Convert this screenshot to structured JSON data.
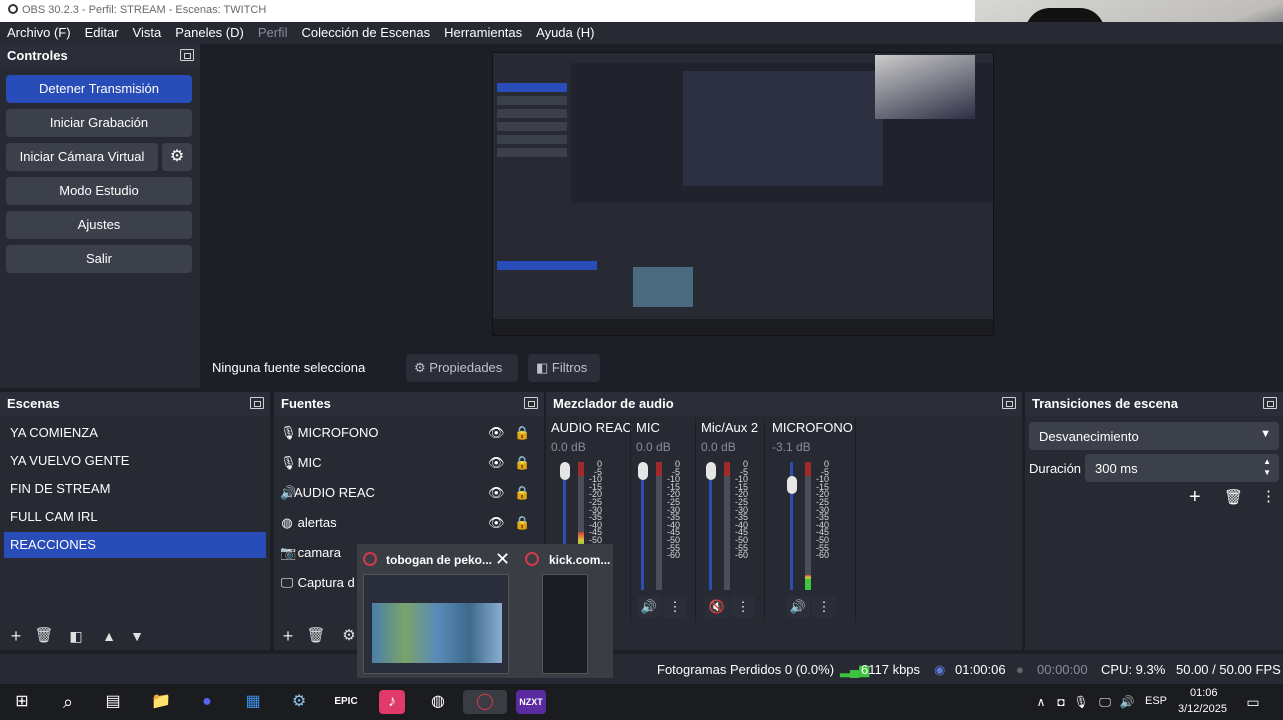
{
  "window": {
    "title": "OBS 30.2.3 - Perfil: STREAM - Escenas: TWITCH"
  },
  "menu": [
    "Archivo (F)",
    "Editar",
    "Vista",
    "Paneles (D)",
    "Perfil",
    "Colección de Escenas",
    "Herramientas",
    "Ayuda (H)"
  ],
  "controls": {
    "title": "Controles",
    "stop_stream": "Detener Transmisión",
    "start_recording": "Iniciar Grabación",
    "virtual_cam": "Iniciar Cámara Virtual",
    "studio_mode": "Modo Estudio",
    "settings": "Ajustes",
    "exit": "Salir"
  },
  "context_bar": {
    "no_source": "Ninguna fuente seleccionada",
    "properties": "Propiedades",
    "filters": "Filtros"
  },
  "scenes": {
    "title": "Escenas",
    "items": [
      "YA COMIENZA",
      "YA VUELVO GENTE",
      "FIN DE STREAM",
      "FULL CAM IRL",
      "REACCIONES"
    ],
    "selected": "REACCIONES"
  },
  "sources": {
    "title": "Fuentes",
    "items": [
      {
        "name": "MICROFONO",
        "icon": "mic-icon"
      },
      {
        "name": "MIC",
        "icon": "mic-icon"
      },
      {
        "name": "AUDIO REAC",
        "icon": "speaker-icon"
      },
      {
        "name": "alertas",
        "icon": "browser-icon"
      },
      {
        "name": "camara",
        "icon": "camera-icon"
      },
      {
        "name": "Captura d",
        "icon": "monitor-icon"
      }
    ]
  },
  "mixer": {
    "title": "Mezclador de audio",
    "channels": [
      {
        "name": "AUDIO REAC",
        "db": "0.0 dB",
        "muted": true,
        "level": 0.45
      },
      {
        "name": "MIC",
        "db": "0.0 dB",
        "muted": false,
        "level": 0.0
      },
      {
        "name": "Mic/Aux 2",
        "db": "0.0 dB",
        "muted": true,
        "level": 0.0
      },
      {
        "name": "MICROFONO",
        "db": "-3.1 dB",
        "muted": false,
        "level": 0.12
      }
    ],
    "scale": [
      "0",
      "-5",
      "-10",
      "-15",
      "-20",
      "-25",
      "-30",
      "-35",
      "-40",
      "-45",
      "-50",
      "-55",
      "-60"
    ]
  },
  "transitions": {
    "title": "Transiciones de escena",
    "selected": "Desvanecimiento",
    "duration_label": "Duración",
    "duration_value": "300 ms"
  },
  "statusbar": {
    "dropped": "Fotogramas Perdidos 0 (0.0%)",
    "bitrate": "6117 kbps",
    "stream_time": "01:00:06",
    "rec_time": "00:00:00",
    "cpu": "CPU: 9.3%",
    "fps": "50.00 / 50.00 FPS"
  },
  "thumbnails": [
    {
      "title": "tobogan de peko..."
    },
    {
      "title": "kick.com..."
    }
  ],
  "taskbar": {
    "language": "ESP",
    "time": "01:06",
    "date": "3/12/2025",
    "app_label": "NZXT"
  },
  "colors": {
    "accent": "#284cb8",
    "panel": "#272a33",
    "background": "#1d1f26"
  }
}
